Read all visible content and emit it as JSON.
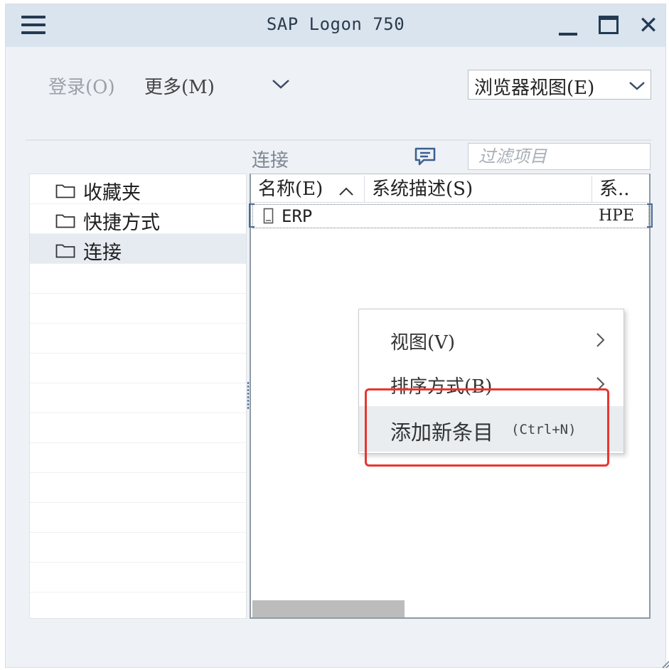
{
  "window": {
    "title": "SAP Logon 750"
  },
  "toolbar": {
    "login_label": "登录(O)",
    "more_label": "更多(M)",
    "view_dropdown_value": "浏览器视图(E)"
  },
  "connections_panel": {
    "heading": "连接",
    "filter_placeholder": "过滤项目"
  },
  "tree": {
    "items": [
      {
        "label": "收藏夹",
        "selected": false
      },
      {
        "label": "快捷方式",
        "selected": false
      },
      {
        "label": "连接",
        "selected": true
      }
    ]
  },
  "list": {
    "columns": [
      "名称(E)",
      "系统描述(S)",
      "系.."
    ],
    "sort_icon": "chevron-up-icon",
    "rows": [
      {
        "name": "ERP",
        "description": "",
        "system": "HPE"
      }
    ]
  },
  "context_menu": {
    "items": [
      {
        "label": "视图(V)",
        "has_submenu": true,
        "shortcut": ""
      },
      {
        "label": "排序方式(B)",
        "has_submenu": true,
        "shortcut": ""
      },
      {
        "label": "添加新条目",
        "has_submenu": false,
        "shortcut": "(Ctrl+N)",
        "highlighted": true
      }
    ]
  },
  "colors": {
    "titlebar_bg": "#d9e4ef",
    "window_bg": "#eef1f5",
    "highlight_box": "#e8362f",
    "icon_color": "#243a52"
  }
}
